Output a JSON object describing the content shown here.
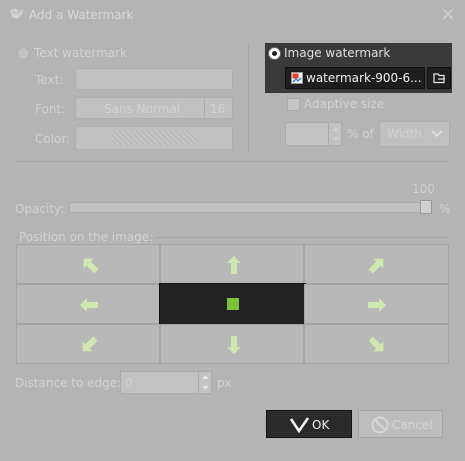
{
  "window": {
    "title": "Add a Watermark"
  },
  "text_watermark": {
    "radio_label": "Text watermark",
    "text_label": "Text:",
    "text_value": "",
    "font_label": "Font:",
    "font_name": "Sans Normal",
    "font_size": "16",
    "color_label": "Color:"
  },
  "image_watermark": {
    "radio_label": "Image watermark",
    "file_name": "watermark-900-6...",
    "adaptive_label": "Adaptive size",
    "percent_value": "",
    "percent_of_label": "% of",
    "dimension_value": "Width"
  },
  "opacity": {
    "label": "Opacity:",
    "value": "100",
    "unit": "%",
    "level": 1.0
  },
  "position": {
    "label": "Position on the image:",
    "selected": "center"
  },
  "distance": {
    "label": "Distance to edge:",
    "value": "0",
    "unit": "px"
  },
  "buttons": {
    "ok": "OK",
    "cancel": "Cancel"
  },
  "colors": {
    "arrow": "#cfe8b0",
    "center_square": "#7cc23a",
    "selected_cell": "#222222",
    "image_panel": "#3a3a3a"
  }
}
